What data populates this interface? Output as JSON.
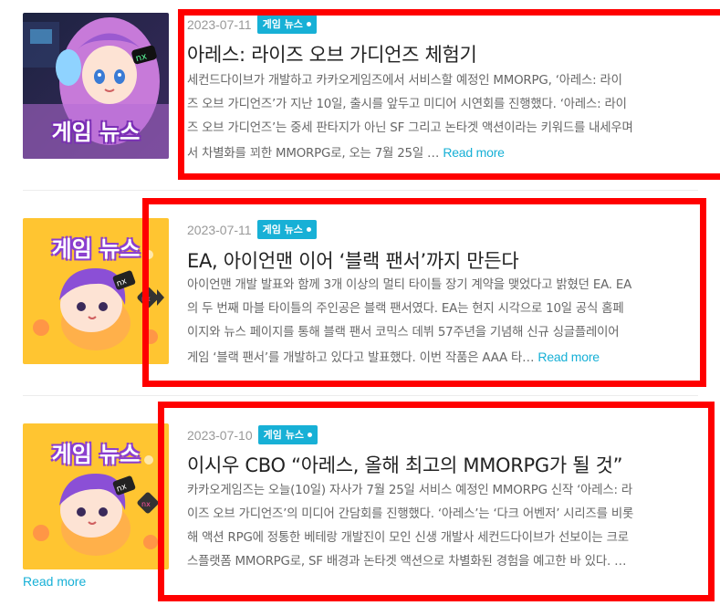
{
  "articles": [
    {
      "date": "2023-07-11",
      "category": "게임 뉴스",
      "thumb_text": "게임 뉴스",
      "title": "아레스: 라이즈 오브 가디언즈 체험기",
      "excerpt_lines": [
        "세컨드다이브가 개발하고 카카오게임즈에서 서비스할 예정인 MMORPG, ‘아레스: 라이",
        "즈 오브 가디언즈’가 지난 10일, 출시를 앞두고 미디어 시연회를 진행했다. ‘아레스: 라이",
        "즈 오브 가디언즈’는 중세 판타지가 아닌 SF 그리고 논타겟 액션이라는 키워드를 내세우며",
        "서 차별화를 꾀한 MMORPG로, 오는 7월 25일 …"
      ],
      "read_more": "Read more"
    },
    {
      "date": "2023-07-11",
      "category": "게임 뉴스",
      "thumb_text": "게임 뉴스",
      "title": "EA, 아이언맨 이어 ‘블랙 팬서’까지 만든다",
      "excerpt_lines": [
        "아이언맨 개발 발표와 함께 3개 이상의 멀티 타이틀 장기 계약을 맺었다고 밝혔던 EA. EA",
        "의 두 번째 마블 타이틀의 주인공은 블랙 팬서였다. EA는 현지 시각으로 10일 공식 홈페",
        "이지와 뉴스 페이지를 통해 블랙 팬서 코믹스 데뷔 57주년을 기념해 신규 싱글플레이어",
        "게임 ‘블랙 팬서’를 개발하고 있다고 발표했다. 이번 작품은 AAA 타…"
      ],
      "read_more": "Read more"
    },
    {
      "date": "2023-07-10",
      "category": "게임 뉴스",
      "thumb_text": "게임 뉴스",
      "title": "이시우 CBO “아레스, 올해 최고의 MMORPG가 될 것”",
      "excerpt_lines": [
        "카카오게임즈는 오늘(10일) 자사가 7월 25일 서비스 예정인 MMORPG 신작 ‘아레스: 라",
        "이즈 오브 가디언즈’의 미디어 간담회를 진행했다. ‘아레스’는 ‘다크 어벤저’ 시리즈를 비롯",
        "해 액션 RPG에 정통한 베테랑 개발진이 모인 신생 개발사 세컨드다이브가 선보이는 크로",
        "스플랫폼 MMORPG로, SF 배경과 논타겟 액션으로 차별화된 경험을 예고한 바 있다. …"
      ],
      "read_more": "Read more"
    }
  ],
  "colors": {
    "accent": "#17b0d6",
    "highlight_box": "#ff0000"
  }
}
